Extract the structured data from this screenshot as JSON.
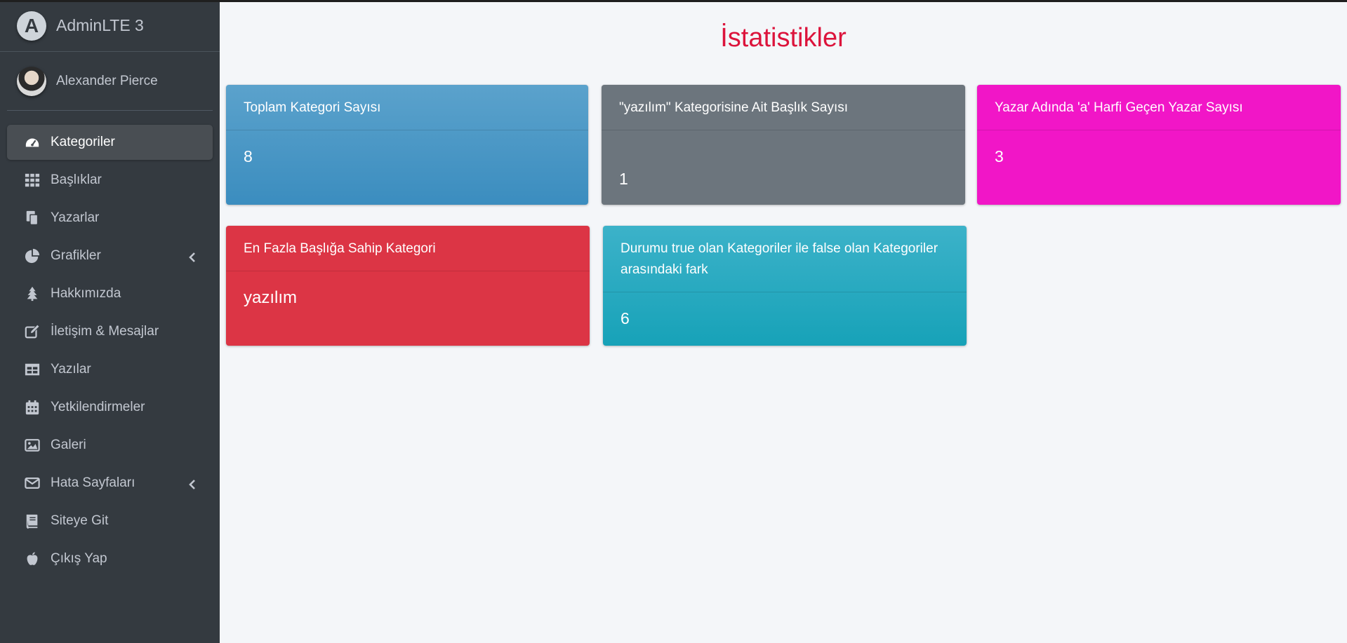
{
  "brand": {
    "letter": "A",
    "name": "AdminLTE 3"
  },
  "user": {
    "name": "Alexander Pierce"
  },
  "sidebar": {
    "items": [
      {
        "label": "Kategoriler",
        "icon": "tachometer-icon"
      },
      {
        "label": "Başlıklar",
        "icon": "grid-icon"
      },
      {
        "label": "Yazarlar",
        "icon": "copy-icon"
      },
      {
        "label": "Grafikler",
        "icon": "pie-chart-icon"
      },
      {
        "label": "Hakkımızda",
        "icon": "tree-icon"
      },
      {
        "label": "İletişim & Mesajlar",
        "icon": "edit-icon"
      },
      {
        "label": "Yazılar",
        "icon": "table-icon"
      },
      {
        "label": "Yetkilendirmeler",
        "icon": "calendar-icon"
      },
      {
        "label": "Galeri",
        "icon": "image-icon"
      },
      {
        "label": "Hata Sayfaları",
        "icon": "envelope-icon"
      },
      {
        "label": "Siteye Git",
        "icon": "book-icon"
      },
      {
        "label": "Çıkış Yap",
        "icon": "apple-icon"
      }
    ]
  },
  "main": {
    "title": "İstatistikler",
    "cards": [
      {
        "header": "Toplam Kategori Sayısı",
        "value": "8",
        "color": "#3c8dbc"
      },
      {
        "header": "\"yazılım\" Kategorisine Ait Başlık Sayısı",
        "value": "1",
        "color": "#6c757d"
      },
      {
        "header": "Yazar Adında 'a' Harfi Geçen Yazar Sayısı",
        "value": "3",
        "color": "#f012be"
      },
      {
        "header": "En Fazla Başlığa Sahip Kategori",
        "value": "yazılım",
        "color": "#dc3545"
      },
      {
        "header": "Durumu true olan Kategoriler ile false olan Kategoriler arasındaki fark",
        "value": "6",
        "color": "#17a2b8"
      }
    ]
  }
}
